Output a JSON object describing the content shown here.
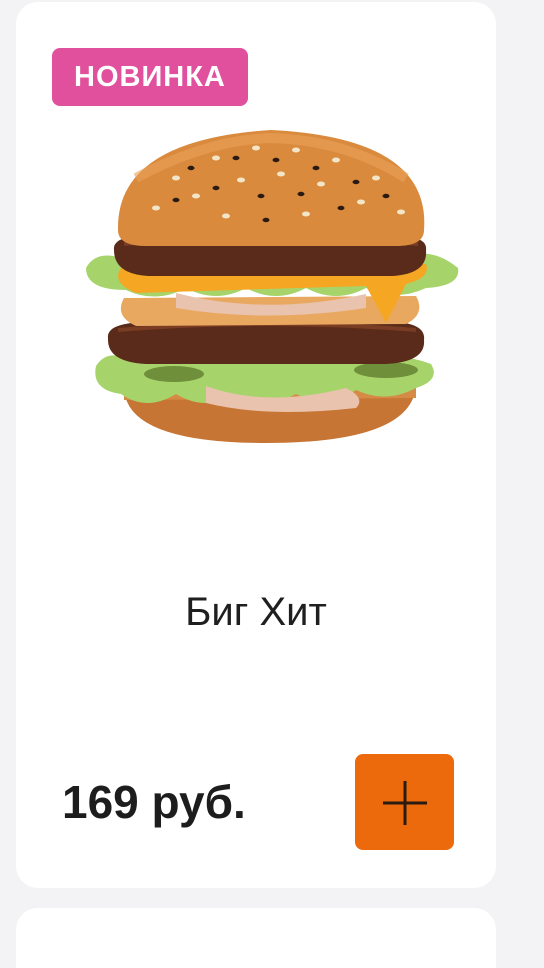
{
  "product": {
    "badge": "НОВИНКА",
    "name": "Биг Хит",
    "price": "169 руб.",
    "image_icon": "burger-image"
  },
  "colors": {
    "badge_bg": "#e0509c",
    "add_button_bg": "#ec6a0c",
    "card_bg": "#ffffff",
    "page_bg": "#f3f3f5"
  },
  "add_button": {
    "icon": "plus-icon"
  }
}
